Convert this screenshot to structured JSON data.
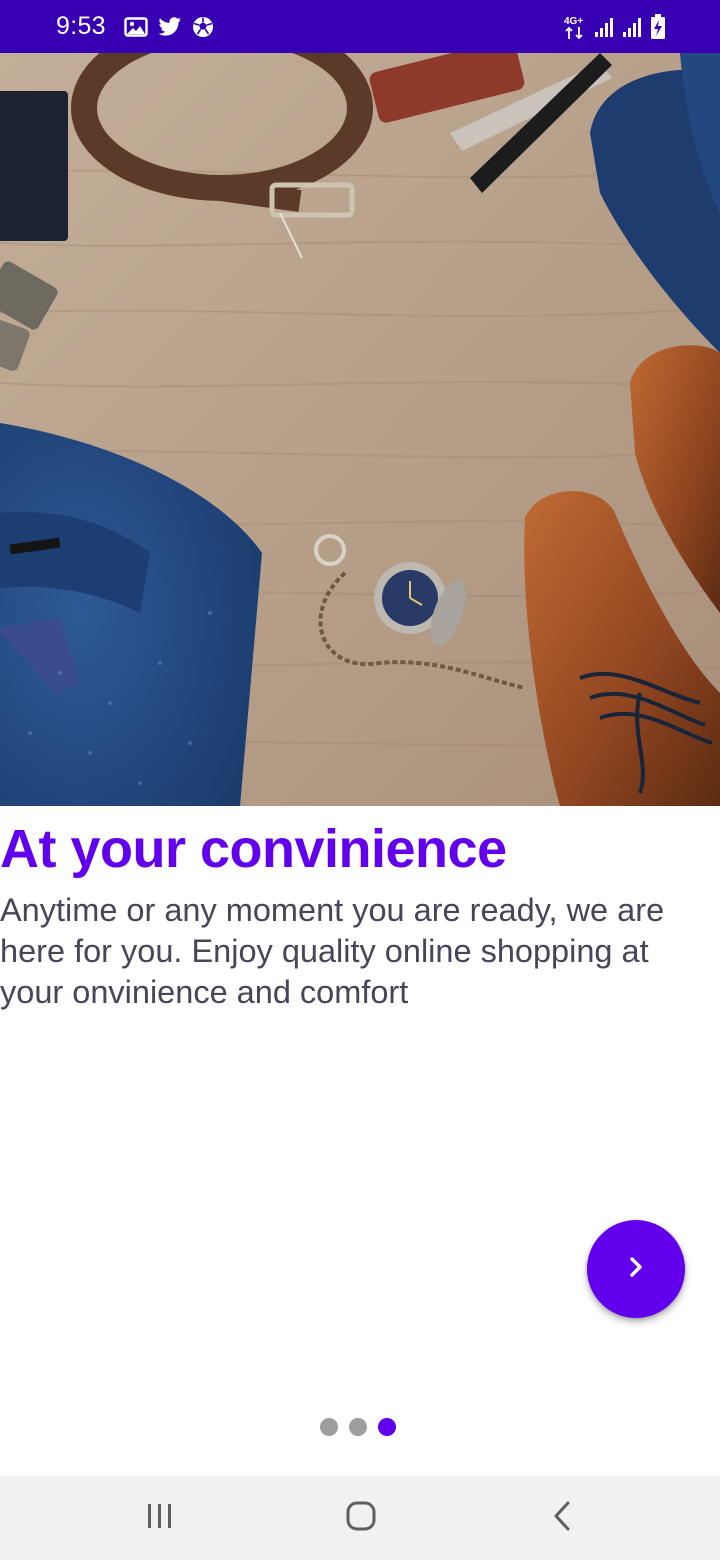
{
  "status_bar": {
    "time": "9:53",
    "background": "#3700b3",
    "left_icons": [
      "image-icon",
      "twitter-icon",
      "soccer-ball-icon"
    ],
    "right_icons": [
      "network-4g-icon",
      "signal-icon",
      "signal-icon",
      "battery-charging-icon"
    ],
    "network_label": "4G+"
  },
  "onboarding": {
    "hero_image": "accessories-flatlay-image",
    "title": "At your convinience",
    "description": "Anytime or any moment you are ready, we are here for you. Enjoy quality online shopping at your onvinience and comfort",
    "next_button_icon": "chevron-right-icon",
    "page_indicator": {
      "total": 3,
      "current": 3
    },
    "colors": {
      "accent": "#6200ee",
      "text_secondary": "#4a4458",
      "dot_inactive": "#9e9e9e"
    }
  },
  "nav_bar": {
    "buttons": [
      "recent-apps-icon",
      "home-icon",
      "back-icon"
    ]
  }
}
